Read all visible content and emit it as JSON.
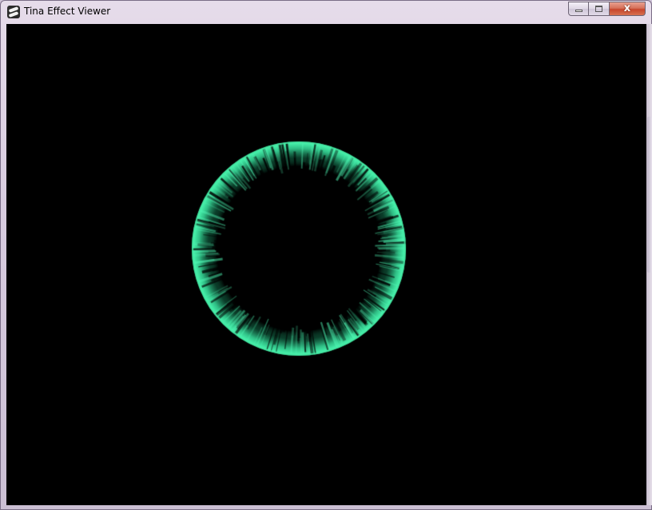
{
  "window": {
    "title": "Tina Effect Viewer",
    "icon": "app-icon",
    "buttons": {
      "minimize_icon": "minimize-icon",
      "maximize_icon": "maximize-icon",
      "close_glyph": "x"
    }
  },
  "viewer": {
    "background_color": "#000000",
    "effect": {
      "shape": "ring",
      "glow_color": "#3ce6a0",
      "core_color": "#000000"
    }
  }
}
